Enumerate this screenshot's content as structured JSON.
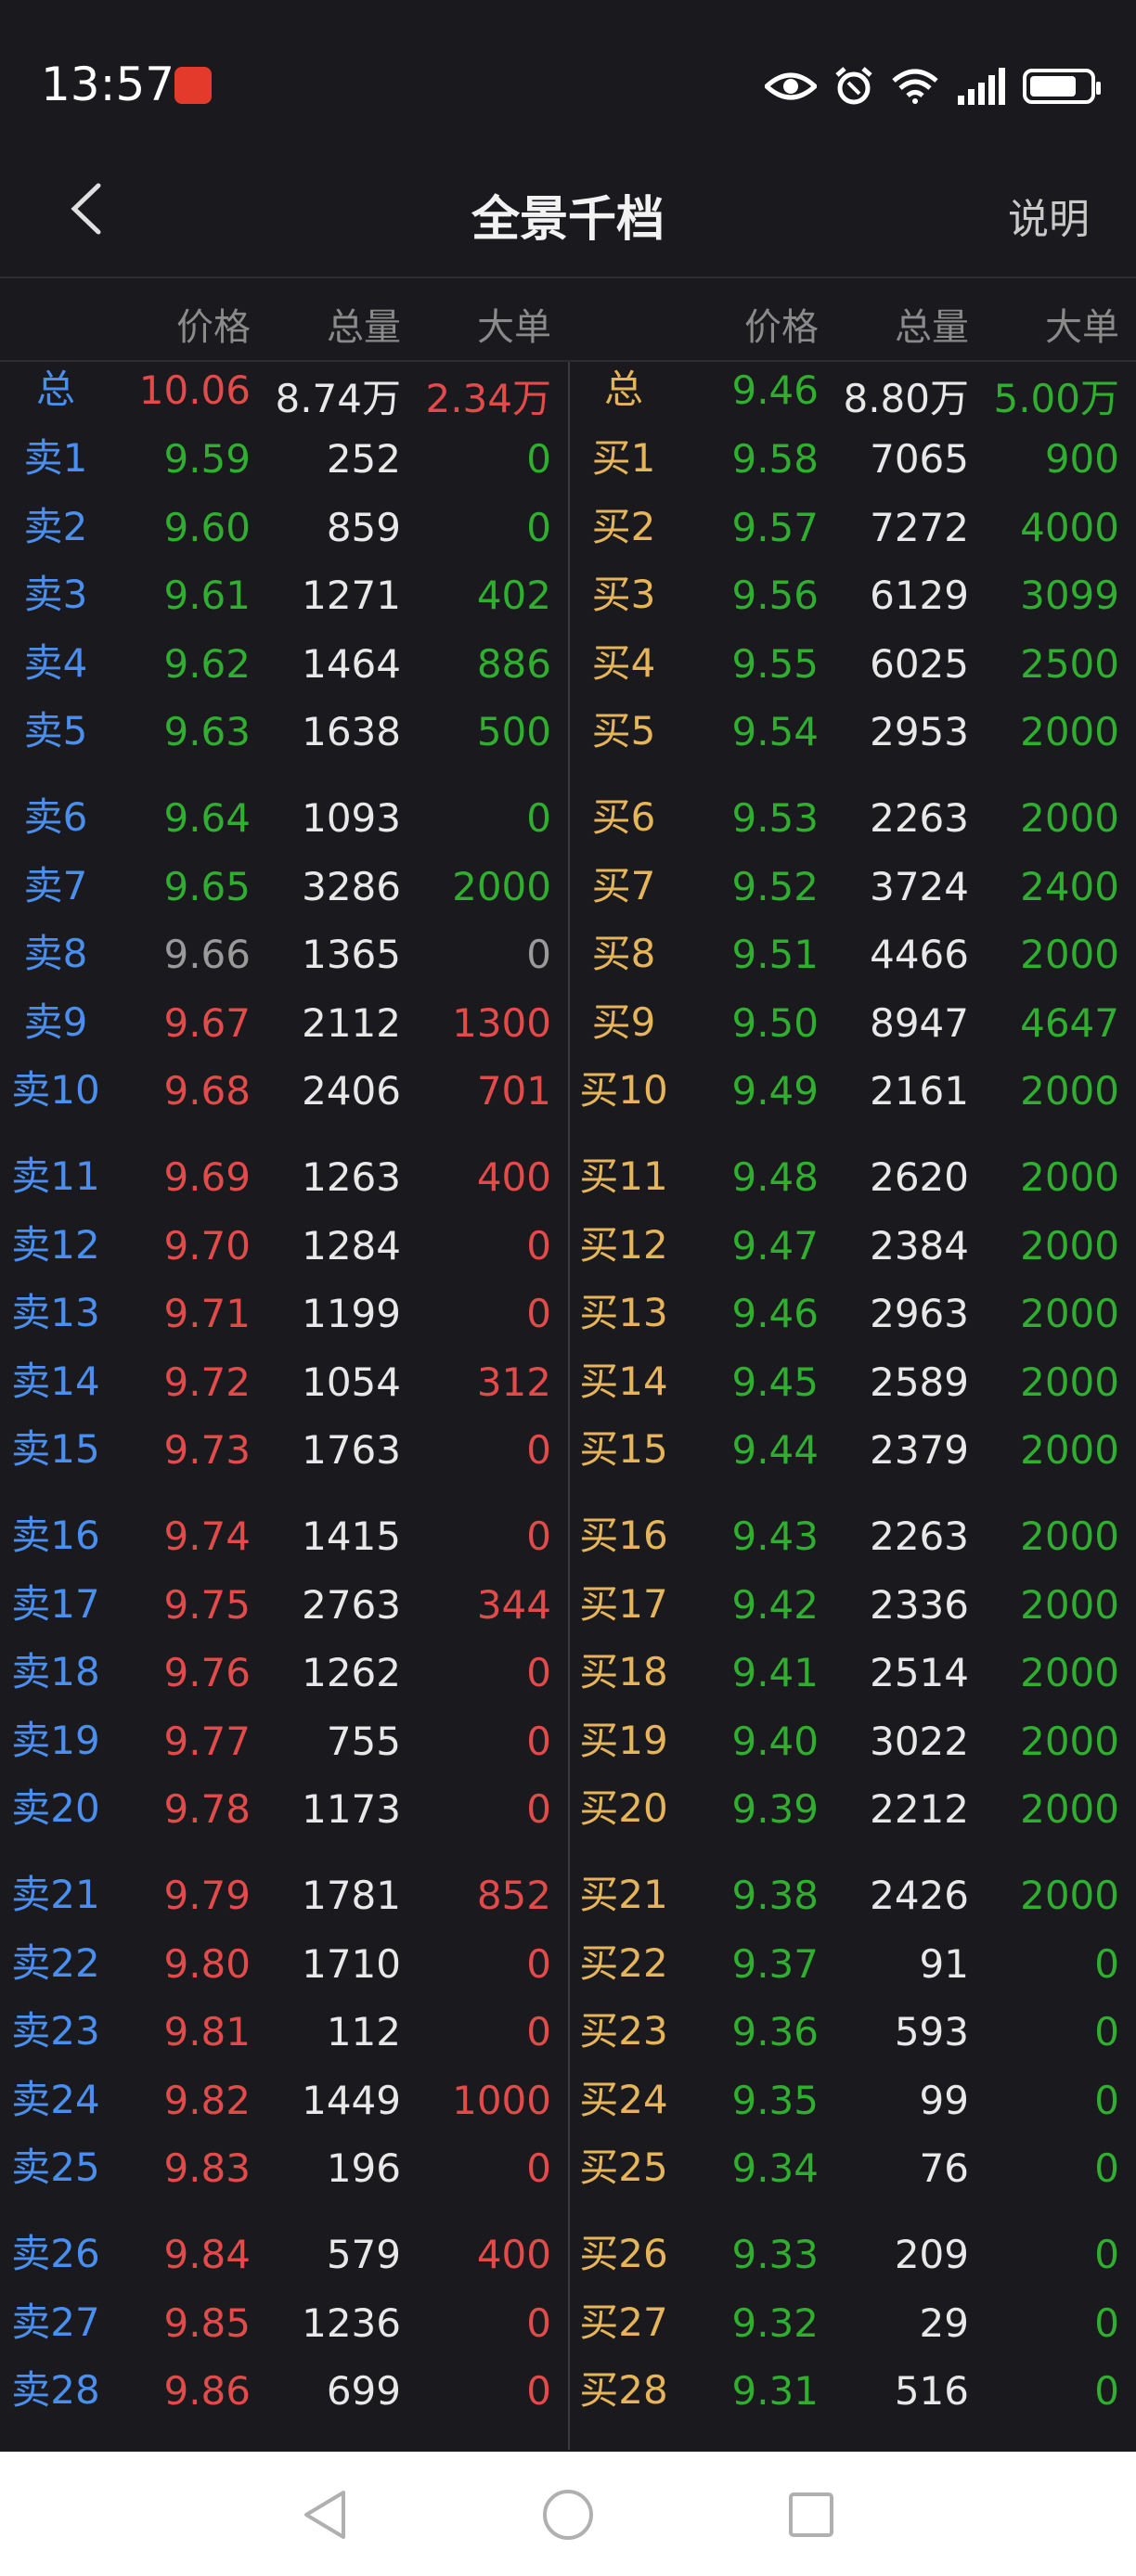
{
  "status_bar": {
    "time": "13:57",
    "icons": [
      "app-badge-icon",
      "eye-icon",
      "alarm-icon",
      "wifi-icon",
      "signal-icon",
      "battery-icon"
    ]
  },
  "header": {
    "title": "全景千档",
    "help_label": "说明"
  },
  "columns": {
    "price": "价格",
    "volume": "总量",
    "big_order": "大单"
  },
  "colors": {
    "blue": "#4a8ff0",
    "gold": "#e6b55a",
    "green": "#2fae2f",
    "red": "#e34a4a",
    "gray": "#9a9a9a"
  },
  "rows": [
    {
      "sl": "总",
      "sp": "10.06",
      "sv": "8.74万",
      "sb": "2.34万",
      "bl": "总",
      "bp": "9.46",
      "bv": "8.80万",
      "bb": "5.00万",
      "spc": "red",
      "sbc": "red",
      "bpc": "green",
      "bbc": "green"
    },
    {
      "sl": "卖1",
      "sp": "9.59",
      "sv": "252",
      "sb": "0",
      "bl": "买1",
      "bp": "9.58",
      "bv": "7065",
      "bb": "900",
      "spc": "green",
      "sbc": "green",
      "bpc": "green",
      "bbc": "green"
    },
    {
      "sl": "卖2",
      "sp": "9.60",
      "sv": "859",
      "sb": "0",
      "bl": "买2",
      "bp": "9.57",
      "bv": "7272",
      "bb": "4000",
      "spc": "green",
      "sbc": "green",
      "bpc": "green",
      "bbc": "green"
    },
    {
      "sl": "卖3",
      "sp": "9.61",
      "sv": "1271",
      "sb": "402",
      "bl": "买3",
      "bp": "9.56",
      "bv": "6129",
      "bb": "3099",
      "spc": "green",
      "sbc": "green",
      "bpc": "green",
      "bbc": "green"
    },
    {
      "sl": "卖4",
      "sp": "9.62",
      "sv": "1464",
      "sb": "886",
      "bl": "买4",
      "bp": "9.55",
      "bv": "6025",
      "bb": "2500",
      "spc": "green",
      "sbc": "green",
      "bpc": "green",
      "bbc": "green"
    },
    {
      "sl": "卖5",
      "sp": "9.63",
      "sv": "1638",
      "sb": "500",
      "bl": "买5",
      "bp": "9.54",
      "bv": "2953",
      "bb": "2000",
      "spc": "green",
      "sbc": "green",
      "bpc": "green",
      "bbc": "green"
    },
    {
      "sl": "卖6",
      "sp": "9.64",
      "sv": "1093",
      "sb": "0",
      "bl": "买6",
      "bp": "9.53",
      "bv": "2263",
      "bb": "2000",
      "spc": "green",
      "sbc": "green",
      "bpc": "green",
      "bbc": "green"
    },
    {
      "sl": "卖7",
      "sp": "9.65",
      "sv": "3286",
      "sb": "2000",
      "bl": "买7",
      "bp": "9.52",
      "bv": "3724",
      "bb": "2400",
      "spc": "green",
      "sbc": "green",
      "bpc": "green",
      "bbc": "green"
    },
    {
      "sl": "卖8",
      "sp": "9.66",
      "sv": "1365",
      "sb": "0",
      "bl": "买8",
      "bp": "9.51",
      "bv": "4466",
      "bb": "2000",
      "spc": "gray",
      "sbc": "gray",
      "bpc": "green",
      "bbc": "green"
    },
    {
      "sl": "卖9",
      "sp": "9.67",
      "sv": "2112",
      "sb": "1300",
      "bl": "买9",
      "bp": "9.50",
      "bv": "8947",
      "bb": "4647",
      "spc": "red",
      "sbc": "red",
      "bpc": "green",
      "bbc": "green"
    },
    {
      "sl": "卖10",
      "sp": "9.68",
      "sv": "2406",
      "sb": "701",
      "bl": "买10",
      "bp": "9.49",
      "bv": "2161",
      "bb": "2000",
      "spc": "red",
      "sbc": "red",
      "bpc": "green",
      "bbc": "green"
    },
    {
      "sl": "卖11",
      "sp": "9.69",
      "sv": "1263",
      "sb": "400",
      "bl": "买11",
      "bp": "9.48",
      "bv": "2620",
      "bb": "2000",
      "spc": "red",
      "sbc": "red",
      "bpc": "green",
      "bbc": "green"
    },
    {
      "sl": "卖12",
      "sp": "9.70",
      "sv": "1284",
      "sb": "0",
      "bl": "买12",
      "bp": "9.47",
      "bv": "2384",
      "bb": "2000",
      "spc": "red",
      "sbc": "red",
      "bpc": "green",
      "bbc": "green"
    },
    {
      "sl": "卖13",
      "sp": "9.71",
      "sv": "1199",
      "sb": "0",
      "bl": "买13",
      "bp": "9.46",
      "bv": "2963",
      "bb": "2000",
      "spc": "red",
      "sbc": "red",
      "bpc": "green",
      "bbc": "green"
    },
    {
      "sl": "卖14",
      "sp": "9.72",
      "sv": "1054",
      "sb": "312",
      "bl": "买14",
      "bp": "9.45",
      "bv": "2589",
      "bb": "2000",
      "spc": "red",
      "sbc": "red",
      "bpc": "green",
      "bbc": "green"
    },
    {
      "sl": "卖15",
      "sp": "9.73",
      "sv": "1763",
      "sb": "0",
      "bl": "买15",
      "bp": "9.44",
      "bv": "2379",
      "bb": "2000",
      "spc": "red",
      "sbc": "red",
      "bpc": "green",
      "bbc": "green"
    },
    {
      "sl": "卖16",
      "sp": "9.74",
      "sv": "1415",
      "sb": "0",
      "bl": "买16",
      "bp": "9.43",
      "bv": "2263",
      "bb": "2000",
      "spc": "red",
      "sbc": "red",
      "bpc": "green",
      "bbc": "green"
    },
    {
      "sl": "卖17",
      "sp": "9.75",
      "sv": "2763",
      "sb": "344",
      "bl": "买17",
      "bp": "9.42",
      "bv": "2336",
      "bb": "2000",
      "spc": "red",
      "sbc": "red",
      "bpc": "green",
      "bbc": "green"
    },
    {
      "sl": "卖18",
      "sp": "9.76",
      "sv": "1262",
      "sb": "0",
      "bl": "买18",
      "bp": "9.41",
      "bv": "2514",
      "bb": "2000",
      "spc": "red",
      "sbc": "red",
      "bpc": "green",
      "bbc": "green"
    },
    {
      "sl": "卖19",
      "sp": "9.77",
      "sv": "755",
      "sb": "0",
      "bl": "买19",
      "bp": "9.40",
      "bv": "3022",
      "bb": "2000",
      "spc": "red",
      "sbc": "red",
      "bpc": "green",
      "bbc": "green"
    },
    {
      "sl": "卖20",
      "sp": "9.78",
      "sv": "1173",
      "sb": "0",
      "bl": "买20",
      "bp": "9.39",
      "bv": "2212",
      "bb": "2000",
      "spc": "red",
      "sbc": "red",
      "bpc": "green",
      "bbc": "green"
    },
    {
      "sl": "卖21",
      "sp": "9.79",
      "sv": "1781",
      "sb": "852",
      "bl": "买21",
      "bp": "9.38",
      "bv": "2426",
      "bb": "2000",
      "spc": "red",
      "sbc": "red",
      "bpc": "green",
      "bbc": "green"
    },
    {
      "sl": "卖22",
      "sp": "9.80",
      "sv": "1710",
      "sb": "0",
      "bl": "买22",
      "bp": "9.37",
      "bv": "91",
      "bb": "0",
      "spc": "red",
      "sbc": "red",
      "bpc": "green",
      "bbc": "green"
    },
    {
      "sl": "卖23",
      "sp": "9.81",
      "sv": "112",
      "sb": "0",
      "bl": "买23",
      "bp": "9.36",
      "bv": "593",
      "bb": "0",
      "spc": "red",
      "sbc": "red",
      "bpc": "green",
      "bbc": "green"
    },
    {
      "sl": "卖24",
      "sp": "9.82",
      "sv": "1449",
      "sb": "1000",
      "bl": "买24",
      "bp": "9.35",
      "bv": "99",
      "bb": "0",
      "spc": "red",
      "sbc": "red",
      "bpc": "green",
      "bbc": "green"
    },
    {
      "sl": "卖25",
      "sp": "9.83",
      "sv": "196",
      "sb": "0",
      "bl": "买25",
      "bp": "9.34",
      "bv": "76",
      "bb": "0",
      "spc": "red",
      "sbc": "red",
      "bpc": "green",
      "bbc": "green"
    },
    {
      "sl": "卖26",
      "sp": "9.84",
      "sv": "579",
      "sb": "400",
      "bl": "买26",
      "bp": "9.33",
      "bv": "209",
      "bb": "0",
      "spc": "red",
      "sbc": "red",
      "bpc": "green",
      "bbc": "green"
    },
    {
      "sl": "卖27",
      "sp": "9.85",
      "sv": "1236",
      "sb": "0",
      "bl": "买27",
      "bp": "9.32",
      "bv": "29",
      "bb": "0",
      "spc": "red",
      "sbc": "red",
      "bpc": "green",
      "bbc": "green"
    },
    {
      "sl": "卖28",
      "sp": "9.86",
      "sv": "699",
      "sb": "0",
      "bl": "买28",
      "bp": "9.31",
      "bv": "516",
      "bb": "0",
      "spc": "red",
      "sbc": "red",
      "bpc": "green",
      "bbc": "green"
    }
  ]
}
